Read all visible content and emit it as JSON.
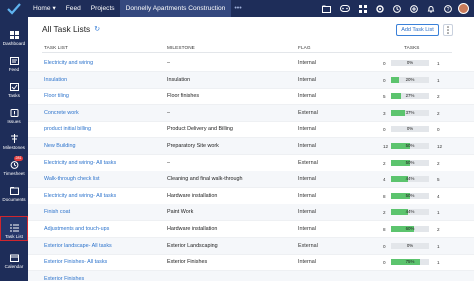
{
  "nav": {
    "items": [
      {
        "label": "Home",
        "has_caret": true
      },
      {
        "label": "Feed"
      },
      {
        "label": "Projects"
      },
      {
        "label": "Donnelly Apartments Construction",
        "active": true
      }
    ],
    "more": "•••",
    "top_icons": [
      "folder-icon",
      "gamepad-icon",
      "apps-icon",
      "settings-icon",
      "clock-icon",
      "add-icon",
      "bell-icon",
      "help-icon"
    ]
  },
  "sidebar": {
    "items": [
      {
        "label": "Dashboard",
        "icon": "dashboard-icon"
      },
      {
        "label": "Feed",
        "icon": "feed-icon"
      },
      {
        "label": "Tasks",
        "icon": "tasks-icon"
      },
      {
        "label": "Issues",
        "icon": "issues-icon"
      },
      {
        "label": "Milestones",
        "icon": "milestones-icon"
      },
      {
        "label": "Timesheet",
        "icon": "timesheet-icon",
        "badge": "281"
      },
      {
        "label": "Documents",
        "icon": "documents-icon"
      },
      {
        "label": "Task List",
        "icon": "task-list-icon",
        "selected": true
      },
      {
        "label": "Calendar",
        "icon": "calendar-icon"
      }
    ]
  },
  "header": {
    "title": "All Task Lists",
    "add_button": "Add Task List"
  },
  "table": {
    "columns": {
      "name": "TASK LIST",
      "milestone": "MILESTONE",
      "flag": "FLAG",
      "tasks": "TASKS"
    },
    "rows": [
      {
        "name": "Electricity and wiring",
        "milestone": "–",
        "flag": "Internal",
        "open": "0",
        "progress": 0,
        "percent": "0%",
        "closed": "1"
      },
      {
        "name": "Insulation",
        "milestone": "Insulation",
        "flag": "Internal",
        "open": "0",
        "progress": 20,
        "percent": "20%",
        "closed": "1"
      },
      {
        "name": "Floor tiling",
        "milestone": "Floor finishes",
        "flag": "Internal",
        "open": "5",
        "progress": 27,
        "percent": "27%",
        "closed": "2"
      },
      {
        "name": "Concrete work",
        "milestone": "–",
        "flag": "External",
        "open": "3",
        "progress": 37,
        "percent": "37%",
        "closed": "2"
      },
      {
        "name": "product initial billing",
        "milestone": "Product Delivery and Billing",
        "flag": "Internal",
        "open": "0",
        "progress": 0,
        "percent": "0%",
        "closed": "0"
      },
      {
        "name": "New Building",
        "milestone": "Preparatory Site work",
        "flag": "Internal",
        "open": "12",
        "progress": 50,
        "percent": "50%",
        "closed": "12"
      },
      {
        "name": "Electricity and wiring- All tasks",
        "milestone": "–",
        "flag": "External",
        "open": "2",
        "progress": 50,
        "percent": "50%",
        "closed": "2"
      },
      {
        "name": "Walk-through check list",
        "milestone": "Cleaning and final walk-through",
        "flag": "Internal",
        "open": "4",
        "progress": 44,
        "percent": "44%",
        "closed": "5"
      },
      {
        "name": "Electricity and wiring- All tasks",
        "milestone": "Hardware installation",
        "flag": "Internal",
        "open": "8",
        "progress": 50,
        "percent": "50%",
        "closed": "4"
      },
      {
        "name": "Finish coat",
        "milestone": "Paint Work",
        "flag": "Internal",
        "open": "2",
        "progress": 44,
        "percent": "44%",
        "closed": "1"
      },
      {
        "name": "Adjustments and touch-ups",
        "milestone": "Hardware installation",
        "flag": "Internal",
        "open": "8",
        "progress": 60,
        "percent": "60%",
        "closed": "2"
      },
      {
        "name": "Exterior landscape- All tasks",
        "milestone": "Exterior Landscaping",
        "flag": "External",
        "open": "0",
        "progress": 0,
        "percent": "0%",
        "closed": "1"
      },
      {
        "name": "Exterior Finishes- All tasks",
        "milestone": "Exterior Finishes",
        "flag": "Internal",
        "open": "0",
        "progress": 75,
        "percent": "75%",
        "closed": "1"
      },
      {
        "name": "Exterior Finishes",
        "milestone": "",
        "flag": "",
        "open": "",
        "progress": 0,
        "percent": "",
        "closed": ""
      }
    ]
  },
  "colors": {
    "topbar": "#1e2d59",
    "link": "#2c73cc",
    "progress": "#5cc46e",
    "selected_border": "#d0262d"
  }
}
